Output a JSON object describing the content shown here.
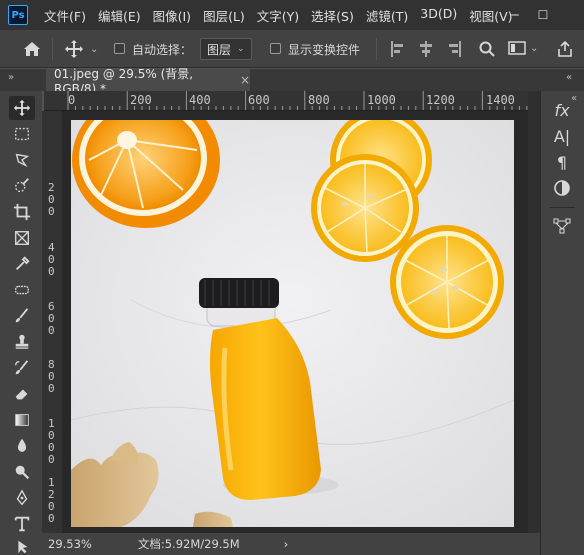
{
  "app": {
    "logo_text": "Ps"
  },
  "menu": [
    "文件(F)",
    "编辑(E)",
    "图像(I)",
    "图层(L)",
    "文字(Y)",
    "选择(S)",
    "滤镜(T)",
    "3D(D)",
    "视图(V)"
  ],
  "window_controls": {
    "minimize": "─",
    "maximize": "☐"
  },
  "options_bar": {
    "auto_select_label": "自动选择：",
    "auto_select_target": "图层",
    "show_transform_label": "显示变换控件"
  },
  "document_tab": {
    "title": "01.jpeg @ 29.5% (背景, RGB/8) *",
    "close": "×"
  },
  "rulers": {
    "top": [
      "0",
      "200",
      "400",
      "600",
      "800",
      "1000",
      "1200",
      "1400"
    ],
    "left": [
      "2",
      "0",
      "0",
      "4",
      "0",
      "0",
      "6",
      "0",
      "0",
      "8",
      "0",
      "0",
      "1",
      "0",
      "0",
      "0",
      "1",
      "2",
      "0",
      "0"
    ]
  },
  "right_panel": {
    "fx": "fx",
    "char": "A|",
    "para": "¶"
  },
  "status": {
    "zoom": "29.53%",
    "doc_size": "文档:5.92M/29.5M",
    "arrow": "›"
  },
  "colors": {
    "menubar": "#323232",
    "panel": "#424242",
    "canvas_bg": "#282828",
    "accent": "#31a8ff"
  }
}
